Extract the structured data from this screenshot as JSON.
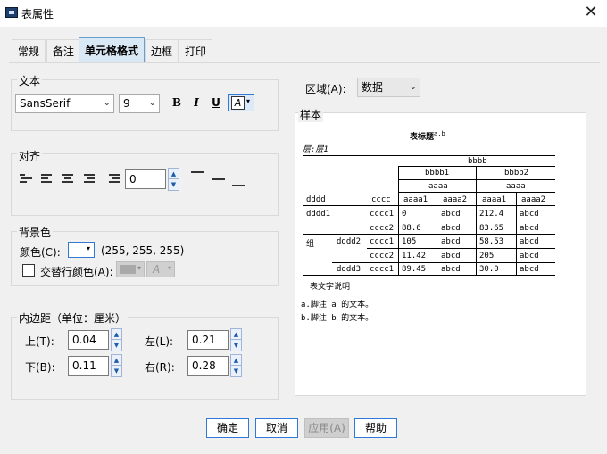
{
  "window": {
    "title": "表属性",
    "close_glyph": "✕"
  },
  "tabs": [
    {
      "label": "常规"
    },
    {
      "label": "备注"
    },
    {
      "label": "单元格格式"
    },
    {
      "label": "边框"
    },
    {
      "label": "打印"
    }
  ],
  "text_group": {
    "label": "文本",
    "font": "SansSerif",
    "size": "9",
    "bold": "B",
    "italic": "I",
    "underline": "U",
    "color_glyph": "A"
  },
  "align_group": {
    "label": "对齐",
    "indent_value": "0"
  },
  "bg_group": {
    "label": "背景色",
    "color_label": "颜色(C):",
    "color_value": "(255, 255, 255)",
    "alt_row_label": "交替行颜色(A):"
  },
  "padding_group": {
    "label": "内边距（单位：厘米）",
    "top_label": "上(T):",
    "top_value": "0.04",
    "left_label": "左(L):",
    "left_value": "0.21",
    "bottom_label": "下(B):",
    "bottom_value": "0.11",
    "right_label": "右(R):",
    "right_value": "0.28"
  },
  "area": {
    "label": "区域(A):",
    "value": "数据"
  },
  "sample": {
    "label": "样本",
    "title": "表标题",
    "title_sup": "a,b",
    "layer": "层:层1",
    "header_bbbb": "bbbb",
    "header_bbbb1": "bbbb1",
    "header_bbbb2": "bbbb2",
    "header_aaaa_a": "aaaa",
    "header_aaaa_b": "aaaa",
    "col_dddd": "dddd",
    "col_cccc": "cccc",
    "cols": [
      "aaaa1",
      "aaaa2",
      "aaaa1",
      "aaaa2"
    ],
    "rows": [
      {
        "d1": "dddd1",
        "d2": "",
        "c": "cccc1",
        "v": [
          "0",
          "abcd",
          "212.4",
          "abcd"
        ]
      },
      {
        "d1": "",
        "d2": "",
        "c": "cccc2",
        "v": [
          "88.6",
          "abcd",
          "83.65",
          "abcd"
        ]
      },
      {
        "d1": "组",
        "d2": "dddd2",
        "c": "cccc1",
        "v": [
          "105",
          "abcd",
          "58.53",
          "abcd"
        ]
      },
      {
        "d1": "",
        "d2": "",
        "c": "cccc2",
        "v": [
          "11.42",
          "abcd",
          "205",
          "abcd"
        ]
      },
      {
        "d1": "",
        "d2": "dddd3",
        "c": "cccc1",
        "v": [
          "89.45",
          "abcd",
          "30.0",
          "abcd"
        ]
      }
    ],
    "caption": "表文字说明",
    "footnote_a": "a.脚注 a 的文本。",
    "footnote_b": "b.脚注 b 的文本。"
  },
  "buttons": {
    "ok": "确定",
    "cancel": "取消",
    "apply": "应用(A)",
    "help": "帮助"
  },
  "colors": {
    "tab_active_bg": "#d9e8f5",
    "button_border": "#2f7ad6"
  }
}
